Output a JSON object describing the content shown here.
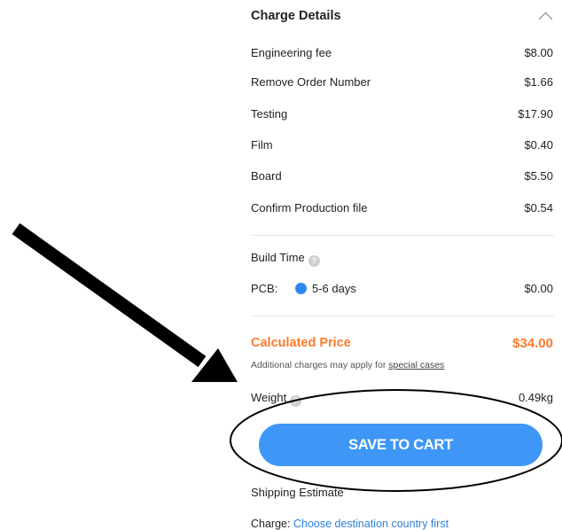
{
  "header": {
    "title": "Charge Details"
  },
  "charges": [
    {
      "label": "Engineering fee",
      "value": "$8.00"
    },
    {
      "label": "Remove Order Number",
      "value": "$1.66"
    },
    {
      "label": "Testing",
      "value": "$17.90"
    },
    {
      "label": "Film",
      "value": "$0.40"
    },
    {
      "label": "Board",
      "value": "$5.50"
    },
    {
      "label": "Confirm Production file",
      "value": "$0.54"
    }
  ],
  "build": {
    "label": "Build Time",
    "pcb_label": "PCB:",
    "pcb_days": "5-6 days",
    "pcb_price": "$0.00"
  },
  "calculated": {
    "label": "Calculated Price",
    "price": "$34.00",
    "note_prefix": "Additional charges may apply for ",
    "note_link": "special cases"
  },
  "weight": {
    "label": "Weight",
    "value": "0.49kg"
  },
  "save_button": {
    "label": "SAVE TO CART"
  },
  "shipping": {
    "label": "Shipping Estimate",
    "charge_prefix": "Charge:",
    "charge_link": "Choose destination country first"
  },
  "colors": {
    "accent_orange": "#ff7a2a",
    "button_blue": "#3e97f6",
    "link_blue": "#2f7fd8"
  }
}
